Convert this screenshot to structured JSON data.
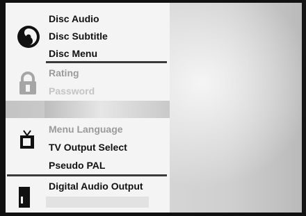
{
  "menu": {
    "disc_group": {
      "icon": "disc-icon",
      "items": [
        "Disc Audio",
        "Disc Subtitle",
        "Disc Menu"
      ]
    },
    "lock_group": {
      "icon": "padlock-icon",
      "items": [
        "Rating",
        "Password"
      ]
    },
    "tv_group": {
      "icon": "tv-icon",
      "items": [
        "Menu Language",
        "TV Output Select",
        "Pseudo PAL"
      ]
    },
    "audio_group": {
      "icon": "speaker-icon",
      "items": [
        "Digital Audio Output"
      ]
    }
  }
}
